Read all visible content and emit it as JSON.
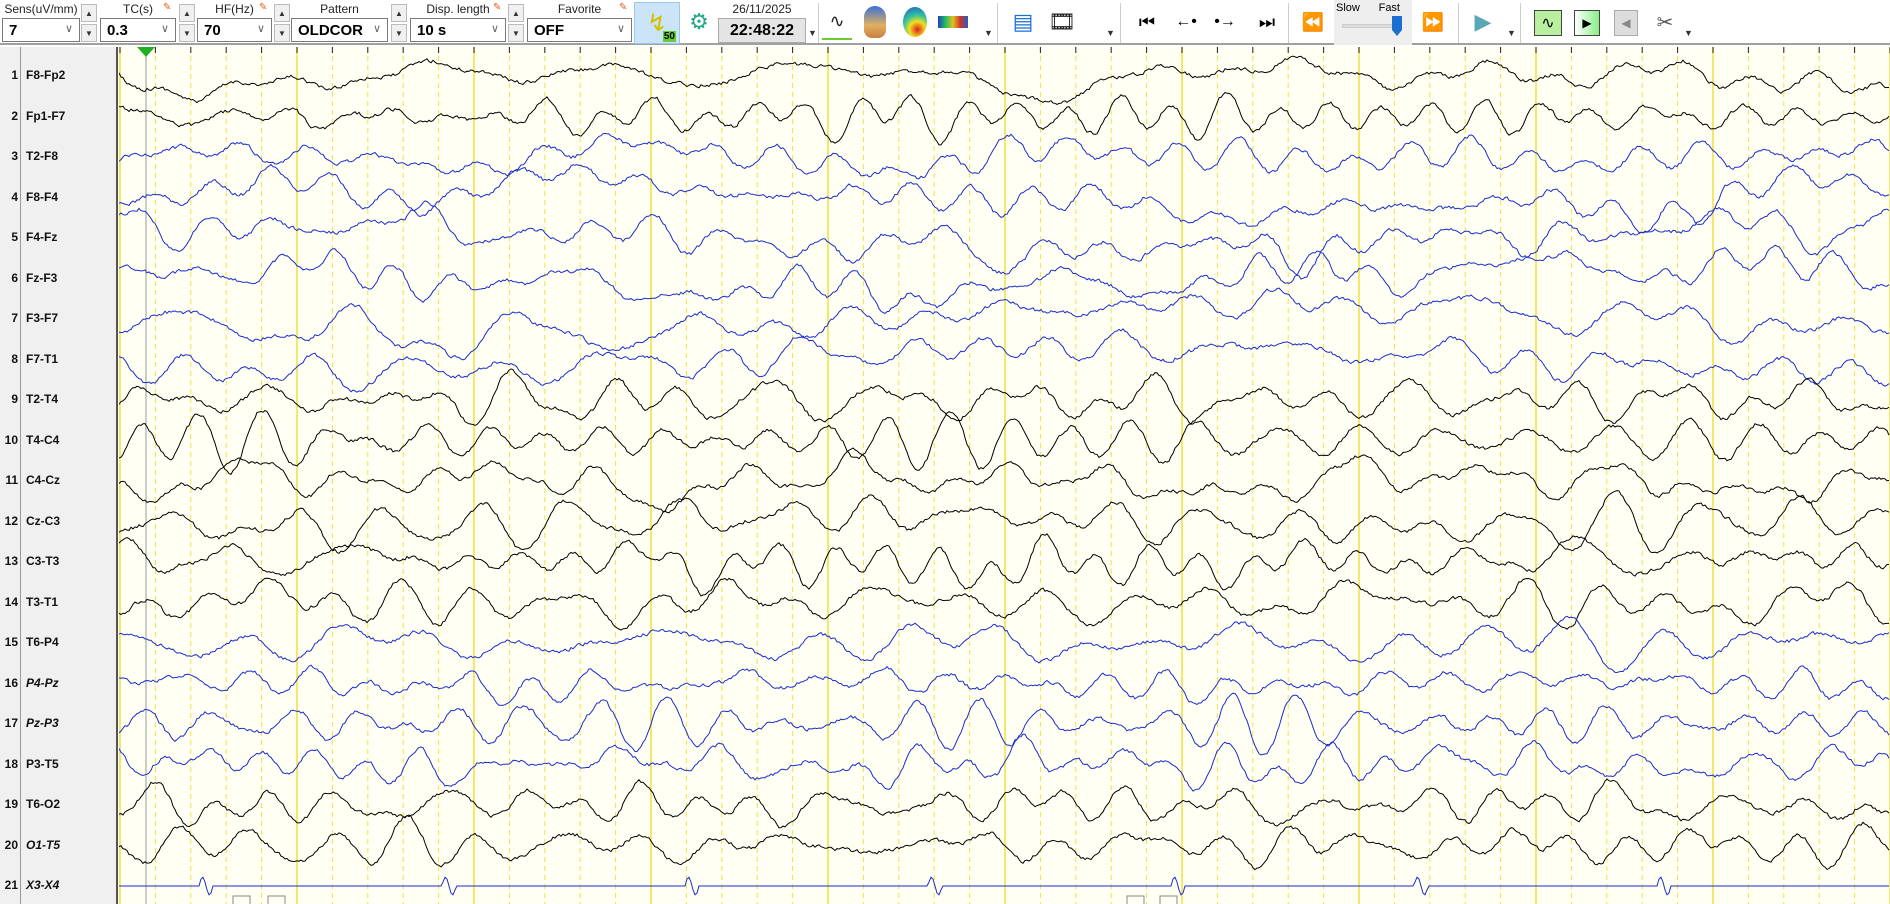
{
  "toolbar": {
    "sens": {
      "label": "Sens(uV/mm)",
      "value": "7"
    },
    "tc": {
      "label": "TC(s)",
      "value": "0.3"
    },
    "hf": {
      "label": "HF(Hz)",
      "value": "70"
    },
    "pattern": {
      "label": "Pattern",
      "value": "OLDCOR"
    },
    "disp_length": {
      "label": "Disp. length",
      "value": "10 s"
    },
    "favorite": {
      "label": "Favorite",
      "value": "OFF"
    },
    "filter_badge": "50",
    "date": "26/11/2025",
    "time": "22:48:22",
    "speed_slow": "Slow",
    "speed_fast": "Fast",
    "speed_value": 1.0
  },
  "channels": [
    {
      "n": "1",
      "name": "F8-Fp2",
      "color": "#000000",
      "italic": false
    },
    {
      "n": "2",
      "name": "Fp1-F7",
      "color": "#000000",
      "italic": false
    },
    {
      "n": "3",
      "name": "T2-F8",
      "color": "#1a2ccc",
      "italic": false
    },
    {
      "n": "4",
      "name": "F8-F4",
      "color": "#1a2ccc",
      "italic": false
    },
    {
      "n": "5",
      "name": "F4-Fz",
      "color": "#1a2ccc",
      "italic": false
    },
    {
      "n": "6",
      "name": "Fz-F3",
      "color": "#1a2ccc",
      "italic": false
    },
    {
      "n": "7",
      "name": "F3-F7",
      "color": "#1a2ccc",
      "italic": false
    },
    {
      "n": "8",
      "name": "F7-T1",
      "color": "#1a2ccc",
      "italic": false
    },
    {
      "n": "9",
      "name": "T2-T4",
      "color": "#000000",
      "italic": false
    },
    {
      "n": "10",
      "name": "T4-C4",
      "color": "#000000",
      "italic": false
    },
    {
      "n": "11",
      "name": "C4-Cz",
      "color": "#000000",
      "italic": false
    },
    {
      "n": "12",
      "name": "Cz-C3",
      "color": "#000000",
      "italic": false
    },
    {
      "n": "13",
      "name": "C3-T3",
      "color": "#000000",
      "italic": false
    },
    {
      "n": "14",
      "name": "T3-T1",
      "color": "#000000",
      "italic": false
    },
    {
      "n": "15",
      "name": "T6-P4",
      "color": "#1a2ccc",
      "italic": false
    },
    {
      "n": "16",
      "name": "P4-Pz",
      "color": "#1a2ccc",
      "italic": true
    },
    {
      "n": "17",
      "name": "Pz-P3",
      "color": "#1a2ccc",
      "italic": true
    },
    {
      "n": "18",
      "name": "P3-T5",
      "color": "#1a2ccc",
      "italic": false
    },
    {
      "n": "19",
      "name": "T6-O2",
      "color": "#000000",
      "italic": false
    },
    {
      "n": "20",
      "name": "O1-T5",
      "color": "#000000",
      "italic": true
    },
    {
      "n": "21",
      "name": "X3-X4",
      "color": "#1a2ccc",
      "italic": true
    }
  ],
  "colors": {
    "grid": "#f2e24a",
    "background": "#fffff4",
    "marker": "#22b022"
  }
}
